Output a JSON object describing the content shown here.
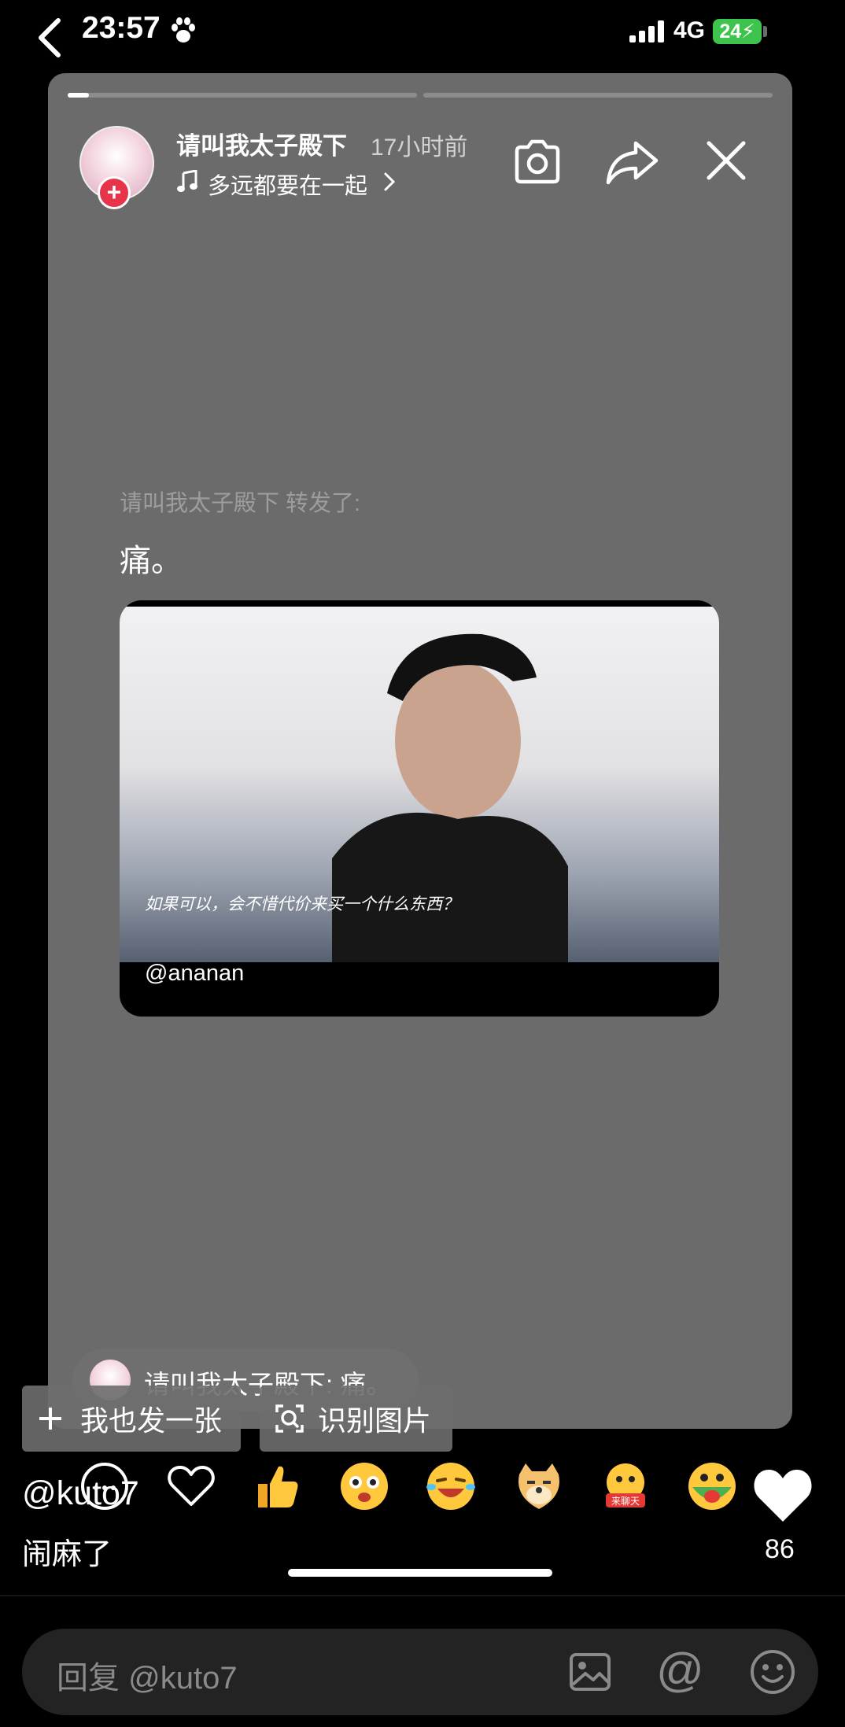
{
  "status_bar": {
    "time": "23:57",
    "network": "4G",
    "battery": "24"
  },
  "story": {
    "username": "请叫我太子殿下",
    "time_ago": "17小时前",
    "music_title": "多远都要在一起",
    "repost_label": "请叫我太子殿下 转发了:",
    "post_text": "痛。",
    "photo_caption": "如果可以，会不惜代价来买一个什么东西？",
    "photo_author": "@ananan",
    "progress": [
      0.06,
      0
    ]
  },
  "comment_bubble": {
    "text": "请叫我太子殿下: 痛。"
  },
  "actions": {
    "me_too": "我也发一张",
    "recognize": "识别图片"
  },
  "reply": {
    "user": "@kuto7",
    "text": "闹麻了"
  },
  "reactions": {
    "icons": [
      "comment-icon",
      "heart-outline-icon",
      "thumbs-up-icon",
      "star-eyes-emoji",
      "laughing-tears-emoji",
      "doge-emoji",
      "lets-chat-emoji",
      "tongue-emoji"
    ],
    "like_count": "86",
    "lets_chat_sticker": "来聊天"
  },
  "input_bar": {
    "placeholder": "回复 @kuto7"
  },
  "colors": {
    "card": "#6b6b6b",
    "battery": "#3ec44d",
    "plus_badge": "#e8344a"
  }
}
